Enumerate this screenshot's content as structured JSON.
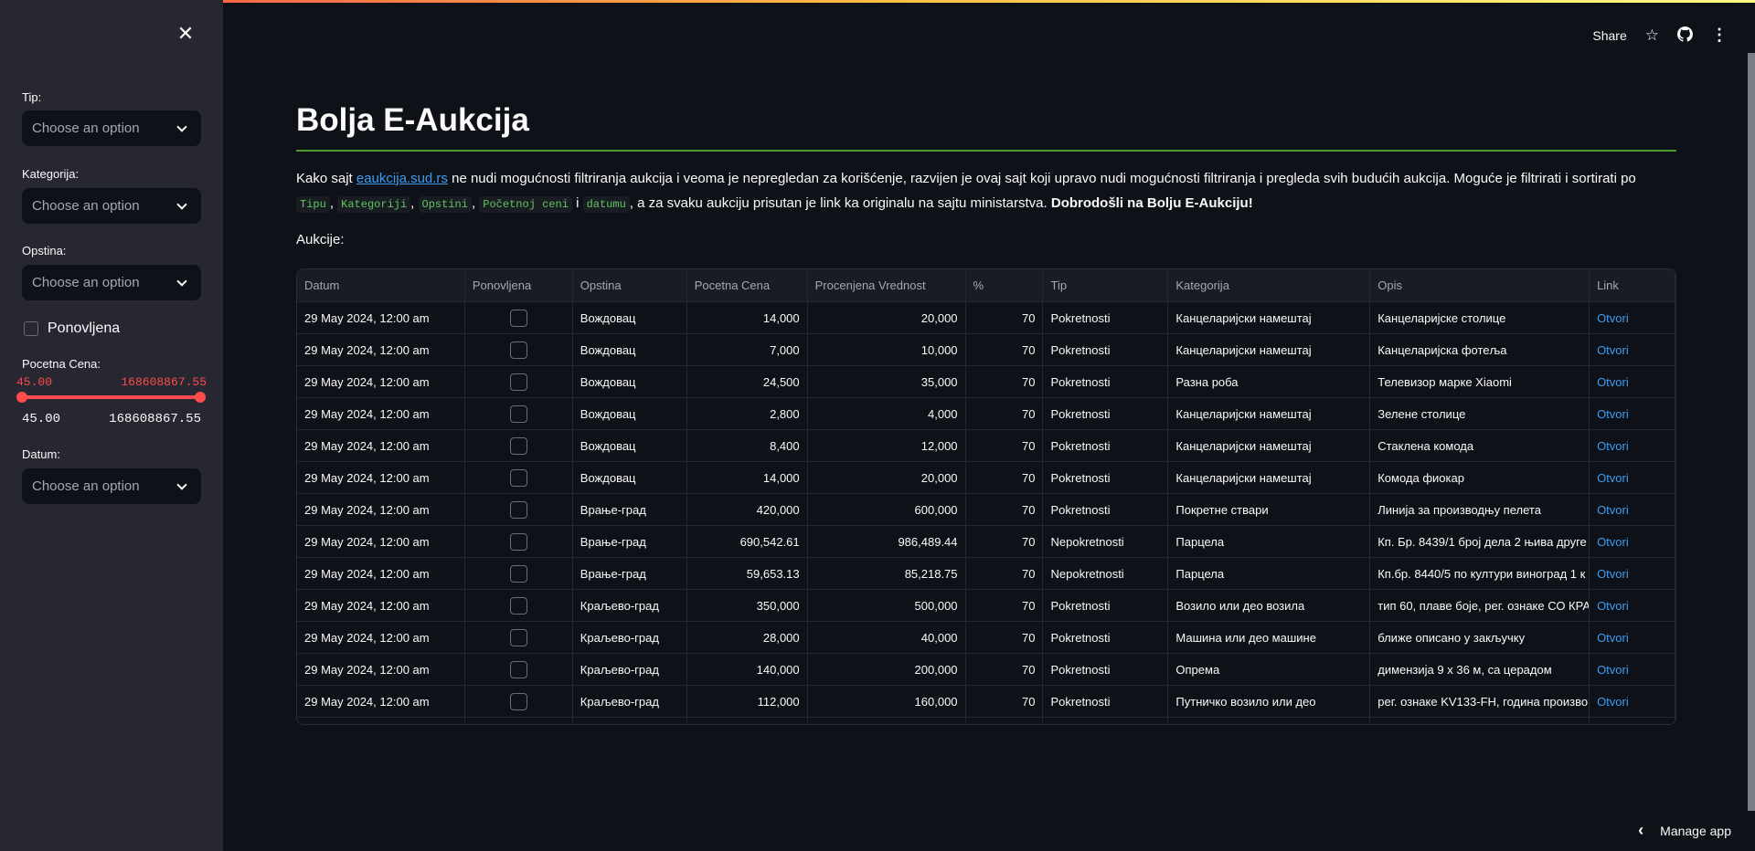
{
  "sidebar": {
    "close_icon": "close-icon",
    "tip_label": "Tip:",
    "tip_placeholder": "Choose an option",
    "kategorija_label": "Kategorija:",
    "kategorija_placeholder": "Choose an option",
    "opstina_label": "Opstina:",
    "opstina_placeholder": "Choose an option",
    "ponovljena_label": "Ponovljena",
    "ponovljena_checked": false,
    "cena_label": "Pocetna Cena:",
    "cena_min": "45.00",
    "cena_max": "168608867.55",
    "cena_range_min": "45.00",
    "cena_range_max": "168608867.55",
    "datum_label": "Datum:",
    "datum_placeholder": "Choose an option"
  },
  "header": {
    "share": "Share",
    "icons": [
      "star-icon",
      "github-icon",
      "more-vertical-icon"
    ]
  },
  "main": {
    "title": "Bolja E-Aukcija",
    "intro_1": "Kako sajt ",
    "link": "eaukcija.sud.rs",
    "intro_2": " ne nudi mogućnosti filtriranja aukcija i veoma je nepregledan za korišćenje, razvijen je ovaj sajt koji upravo nudi mogućnosti filtriranja i pregleda svih budućih aukcija. Moguće je filtrirati i sortirati po ",
    "codes": [
      "Tipu",
      "Kategoriji",
      "Opstini",
      "Početnoj ceni",
      "datumu"
    ],
    "sep_comma": ", ",
    "sep_i": " i ",
    "intro_3": ", a za svaku aukciju prisutan je link ka originalu na sajtu ministarstva. ",
    "intro_bold": "Dobrodošli na Bolju E-Aukciju!",
    "aukcije_label": "Aukcije:"
  },
  "table": {
    "columns": [
      "Datum",
      "Ponovljena",
      "Opstina",
      "Pocetna Cena",
      "Procenjena Vrednost",
      "%",
      "Tip",
      "Kategorija",
      "Opis",
      "Link"
    ],
    "rows": [
      [
        "29 May 2024, 12:00 am",
        false,
        "Вождовац",
        "14,000",
        "20,000",
        "70",
        "Pokretnosti",
        "Канцеларијски намештај",
        "Канцеларијске столице",
        "Otvori"
      ],
      [
        "29 May 2024, 12:00 am",
        false,
        "Вождовац",
        "7,000",
        "10,000",
        "70",
        "Pokretnosti",
        "Канцеларијски намештај",
        "Канцеларијска фотеља",
        "Otvori"
      ],
      [
        "29 May 2024, 12:00 am",
        false,
        "Вождовац",
        "24,500",
        "35,000",
        "70",
        "Pokretnosti",
        "Разна роба",
        "Телевизор марке Xiaomi",
        "Otvori"
      ],
      [
        "29 May 2024, 12:00 am",
        false,
        "Вождовац",
        "2,800",
        "4,000",
        "70",
        "Pokretnosti",
        "Канцеларијски намештај",
        "Зелене столице",
        "Otvori"
      ],
      [
        "29 May 2024, 12:00 am",
        false,
        "Вождовац",
        "8,400",
        "12,000",
        "70",
        "Pokretnosti",
        "Канцеларијски намештај",
        "Стаклена комода",
        "Otvori"
      ],
      [
        "29 May 2024, 12:00 am",
        false,
        "Вождовац",
        "14,000",
        "20,000",
        "70",
        "Pokretnosti",
        "Канцеларијски намештај",
        "Комода фиокар",
        "Otvori"
      ],
      [
        "29 May 2024, 12:00 am",
        false,
        "Врање-град",
        "420,000",
        "600,000",
        "70",
        "Pokretnosti",
        "Покретне ствари",
        "Линија за производњу пелета",
        "Otvori"
      ],
      [
        "29 May 2024, 12:00 am",
        false,
        "Врање-град",
        "690,542.61",
        "986,489.44",
        "70",
        "Nepokretnosti",
        "Парцела",
        "Кп. Бр. 8439/1 број дела 2 њива друге",
        "Otvori"
      ],
      [
        "29 May 2024, 12:00 am",
        false,
        "Врање-град",
        "59,653.13",
        "85,218.75",
        "70",
        "Nepokretnosti",
        "Парцела",
        "Кп.бр. 8440/5 по култури виноград 1 к",
        "Otvori"
      ],
      [
        "29 May 2024, 12:00 am",
        false,
        "Краљево-град",
        "350,000",
        "500,000",
        "70",
        "Pokretnosti",
        "Возило или део возила",
        "тип 60, плаве боје, рег. ознаке СО КРА",
        "Otvori"
      ],
      [
        "29 May 2024, 12:00 am",
        false,
        "Краљево-град",
        "28,000",
        "40,000",
        "70",
        "Pokretnosti",
        "Машина или део машине",
        "ближе описано у закључку",
        "Otvori"
      ],
      [
        "29 May 2024, 12:00 am",
        false,
        "Краљево-град",
        "140,000",
        "200,000",
        "70",
        "Pokretnosti",
        "Опрема",
        " димензија 9 x 36 м, са церадом",
        "Otvori"
      ],
      [
        "29 May 2024, 12:00 am",
        false,
        "Краљево-град",
        "112,000",
        "160,000",
        "70",
        "Pokretnosti",
        "Путничко возило или део",
        " рег. ознаке KV133-FH, година произво",
        "Otvori"
      ]
    ]
  },
  "footer": {
    "manage_app": "Manage app"
  },
  "colors": {
    "accent": "#ff4b4b",
    "link": "#3d9df3",
    "divider": "#4c9a2a",
    "background": "#0e1117",
    "sidebar": "#262730"
  }
}
